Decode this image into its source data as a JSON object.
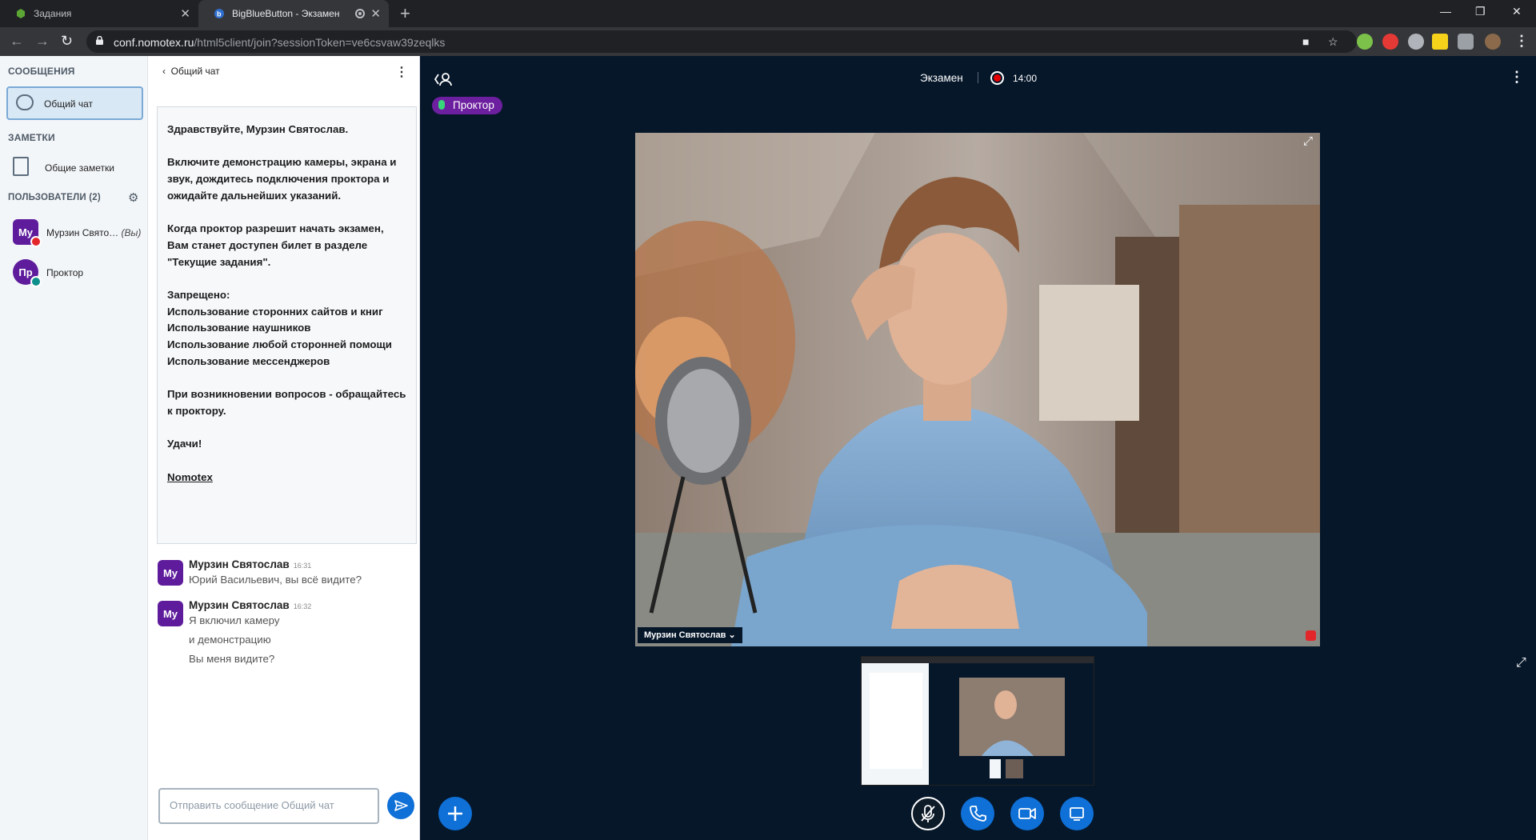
{
  "browser": {
    "tabs": [
      {
        "title": "Задания",
        "favicon_color": "#5ba634"
      },
      {
        "title": "BigBlueButton - Экзамен",
        "favicon_color": "#2f6fd0"
      }
    ],
    "url_host": "conf.nomotex.ru",
    "url_path": "/html5client/join?sessionToken=ve6csvaw39zeqlks"
  },
  "sidebar": {
    "messages_title": "СООБЩЕНИЯ",
    "public_chat_label": "Общий чат",
    "notes_title": "ЗАМЕТКИ",
    "shared_notes_label": "Общие заметки",
    "users_title": "ПОЛЬЗОВАТЕЛИ (2)",
    "users": [
      {
        "initials": "Му",
        "name": "Мурзин Свято…",
        "you": "(Вы)",
        "avatar_color": "#5e1c9c",
        "badge_color": "#e3262a"
      },
      {
        "initials": "Пр",
        "name": "Проктор",
        "avatar_color": "#5e1c9c",
        "badge_color": "#0d8f8c"
      }
    ]
  },
  "chat": {
    "header": "Общий чат",
    "welcome": {
      "greeting": "Здравствуйте, Мурзин Святослав.",
      "para1": "Включите демонстрацию камеры, экрана и звук, дождитесь подключения проктора и ожидайте дальнейших указаний.",
      "para2": "Когда проктор разрешит начать экзамен, Вам станет доступен билет в разделе \"Текущие задания\".",
      "forbidden_title": "Запрещено:",
      "forbidden_1": "Использование сторонних сайтов и книг",
      "forbidden_2": "Использование наушников",
      "forbidden_3": "Использование любой сторонней помощи",
      "forbidden_4": "Использование мессенджеров",
      "para3": "При возникновении вопросов - обращайтесь к проктору.",
      "good_luck": "Удачи!",
      "signature": "Nomotex"
    },
    "messages": [
      {
        "initials": "Му",
        "author": "Мурзин Святослав",
        "time": "16:31",
        "lines": [
          "Юрий Васильевич, вы всё видите?"
        ]
      },
      {
        "initials": "Му",
        "author": "Мурзин Святослав",
        "time": "16:32",
        "lines": [
          "Я включил камеру",
          "и демонстрацию",
          "Вы меня видите?"
        ]
      }
    ],
    "input_placeholder": "Отправить сообщение Общий чат",
    "input_value": ""
  },
  "meeting": {
    "title": "Экзамен",
    "recording_time": "14:00",
    "talking_indicator": "Проктор",
    "video_user": "Мурзин Святослав",
    "accent_color": "#0f70d7",
    "recording_color": "#e60000"
  },
  "actions": {
    "icons": [
      "plus-icon",
      "mic-muted-icon",
      "phone-icon",
      "camera-icon",
      "screen-share-icon"
    ]
  }
}
